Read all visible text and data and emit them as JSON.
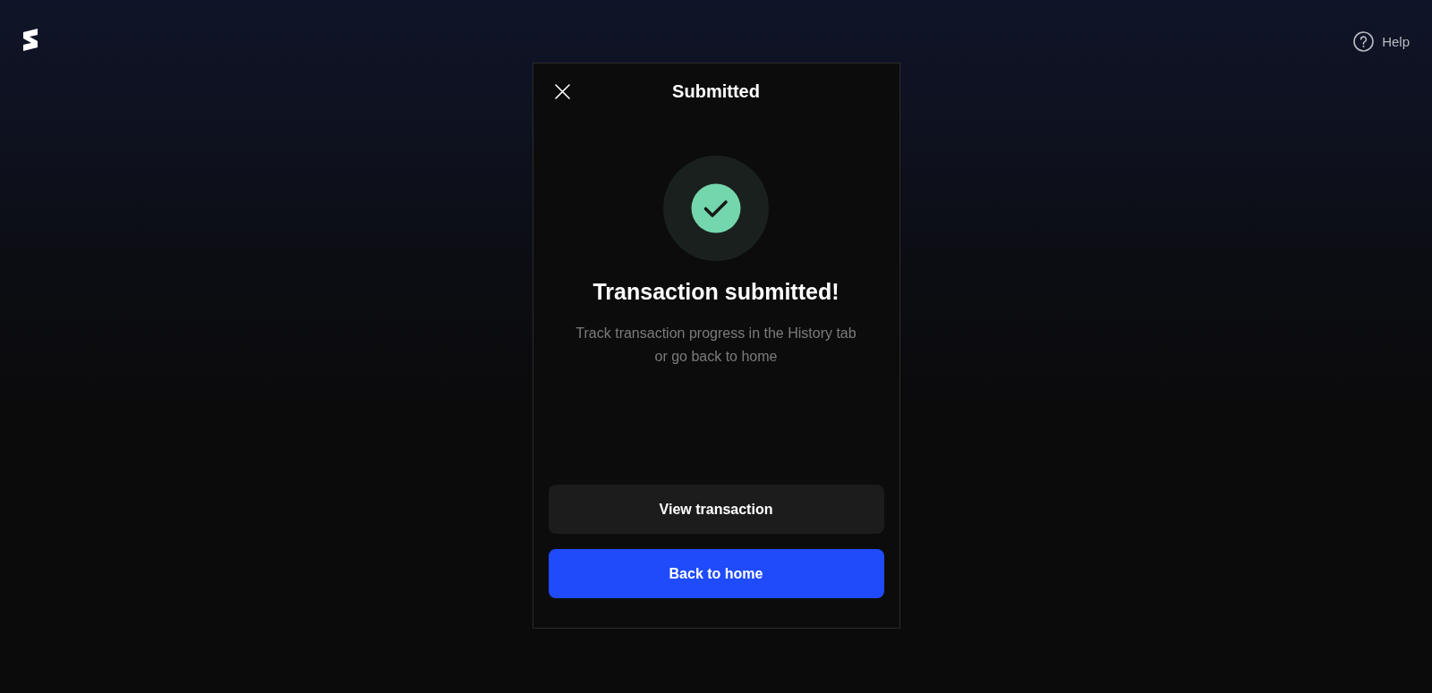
{
  "header": {
    "help": {
      "label": "Help"
    }
  },
  "modal": {
    "title": "Submitted",
    "status": {
      "kind": "success"
    },
    "heading": "Transaction submitted!",
    "message": "Track transaction progress in the History tab or go back to home",
    "actions": [
      {
        "label": "View transaction",
        "kind": "secondary"
      },
      {
        "label": "Back to home",
        "kind": "primary"
      }
    ]
  }
}
